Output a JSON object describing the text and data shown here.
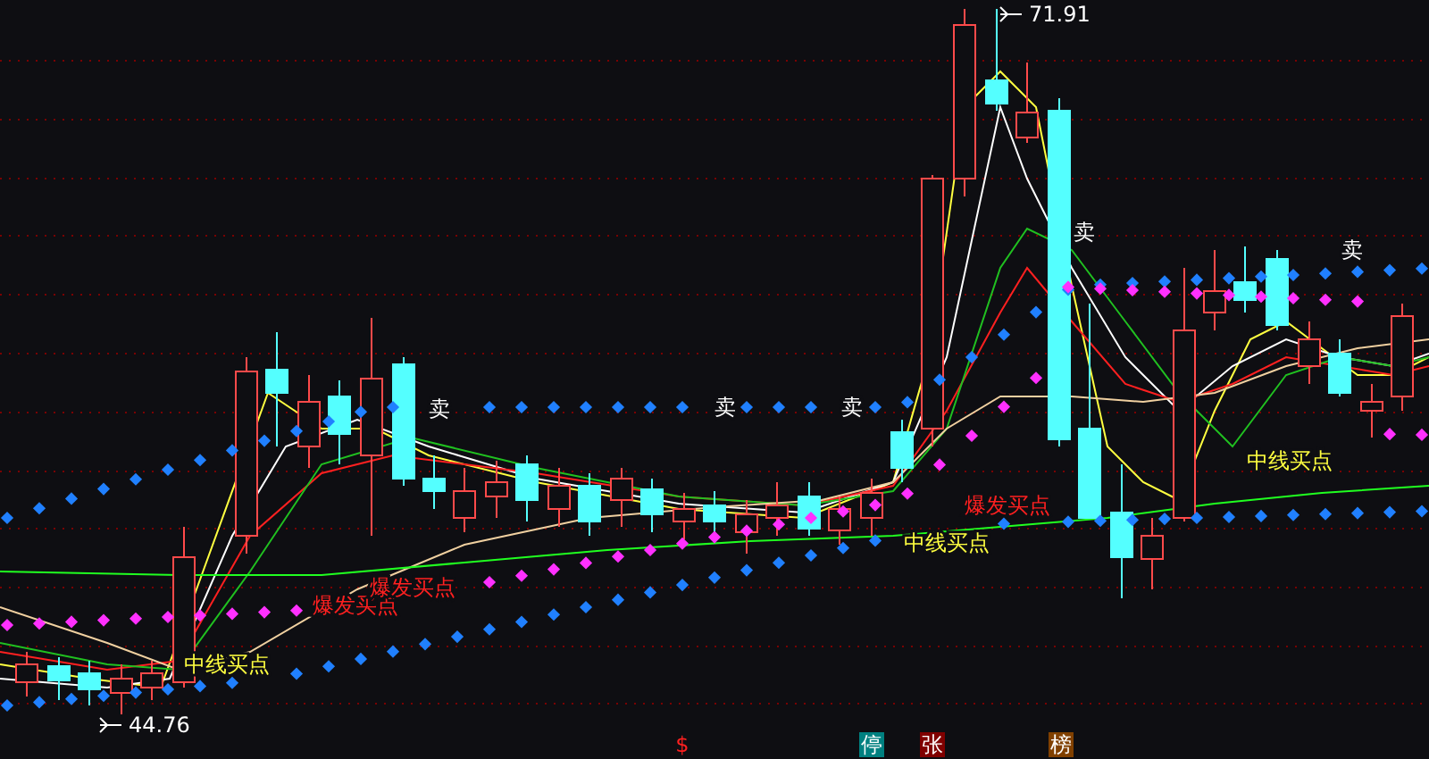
{
  "price_markers": [
    {
      "kind": "high",
      "text": "71.91"
    },
    {
      "kind": "low",
      "text": "44.76"
    }
  ],
  "signals": [
    {
      "kind": "sell",
      "text": "卖"
    },
    {
      "kind": "sell",
      "text": "卖"
    },
    {
      "kind": "sell",
      "text": "卖"
    },
    {
      "kind": "sell",
      "text": "卖"
    },
    {
      "kind": "sell",
      "text": "卖"
    },
    {
      "kind": "midline_buy",
      "text": "中线买点"
    },
    {
      "kind": "burst_buy",
      "text": "爆发买点"
    },
    {
      "kind": "burst_buy",
      "text": "爆发买点"
    },
    {
      "kind": "burst_buy",
      "text": "爆发买点"
    },
    {
      "kind": "midline_buy",
      "text": "中线买点"
    },
    {
      "kind": "midline_buy",
      "text": "中线买点"
    }
  ],
  "tags": [
    {
      "text": "$",
      "color": "#ff2020",
      "filled": false
    },
    {
      "text": "停",
      "color": "#008080",
      "filled": true
    },
    {
      "text": "张",
      "color": "#800000",
      "filled": true
    },
    {
      "text": "榜",
      "color": "#804000",
      "filled": true
    }
  ]
}
